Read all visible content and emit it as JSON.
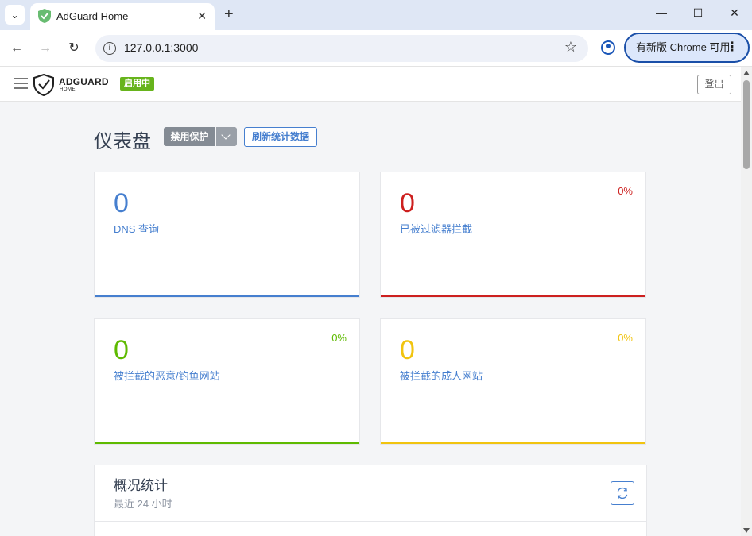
{
  "browser": {
    "tab_title": "AdGuard Home",
    "url": "127.0.0.1:3000",
    "update_button": "有新版 Chrome 可用"
  },
  "header": {
    "logo_text": "ADGUARD",
    "logo_sub": "HOME",
    "status_badge": "启用中",
    "logout": "登出"
  },
  "dashboard": {
    "title": "仪表盘",
    "disable_button": "禁用保护",
    "refresh_button": "刷新统计数据"
  },
  "cards": [
    {
      "value": "0",
      "label": "DNS 查询",
      "percent": "",
      "color": "#467fcf"
    },
    {
      "value": "0",
      "label": "已被过滤器拦截",
      "percent": "0%",
      "color": "#cd201f"
    },
    {
      "value": "0",
      "label": "被拦截的恶意/钓鱼网站",
      "percent": "0%",
      "color": "#5eba00"
    },
    {
      "value": "0",
      "label": "被拦截的成人网站",
      "percent": "0%",
      "color": "#f1c40f"
    }
  ],
  "overview": {
    "title": "概况统计",
    "subtitle": "最近 24 小时"
  },
  "icons": [
    "chevron-down-icon",
    "shield-check-icon",
    "close-icon",
    "plus-icon",
    "minimize-icon",
    "maximize-icon",
    "back-icon",
    "forward-icon",
    "reload-icon",
    "info-icon",
    "star-icon",
    "profile-icon",
    "menu-icon",
    "refresh-icon"
  ]
}
